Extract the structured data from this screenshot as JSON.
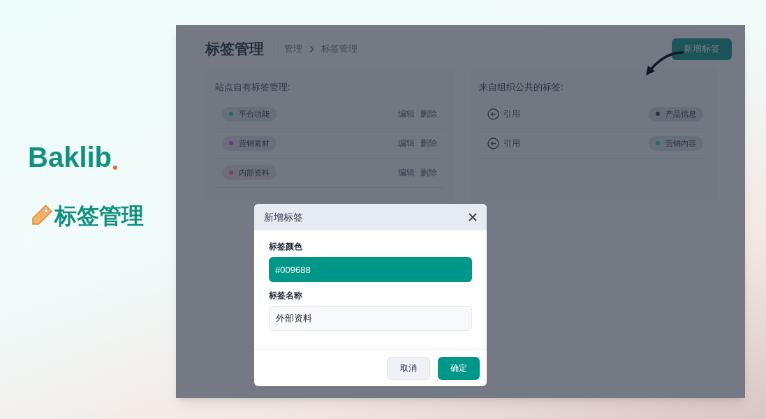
{
  "promo": {
    "brand": "Baklib",
    "headline": "标签管理"
  },
  "page": {
    "title": "标签管理",
    "breadcrumb": [
      "管理",
      "标签管理"
    ],
    "new_button": "新增标签",
    "own_tags": {
      "heading": "站点自有标签管理:",
      "items": [
        {
          "name": "平台功能",
          "color": "#1f6e68",
          "actions": [
            "编辑",
            "删除"
          ]
        },
        {
          "name": "营销素材",
          "color": "#6a3d78",
          "actions": [
            "编辑",
            "删除"
          ]
        },
        {
          "name": "内部资料",
          "color": "#8c3a5a",
          "actions": [
            "编辑",
            "删除"
          ]
        }
      ]
    },
    "org_tags": {
      "heading": "来自组织公共的标签:",
      "items": [
        {
          "action": "引用",
          "name": "产品信息",
          "color": "#2f3440"
        },
        {
          "action": "引用",
          "name": "营销内容",
          "color": "#1f6e68"
        }
      ]
    }
  },
  "dialog": {
    "title": "新增标签",
    "fields": [
      {
        "label": "标签颜色",
        "value": "#009688",
        "kind": "color"
      },
      {
        "label": "标签名称",
        "value": "外部资料",
        "kind": "text"
      }
    ],
    "buttons": [
      {
        "label": "取消",
        "kind": "secondary"
      },
      {
        "label": "确定",
        "kind": "primary"
      }
    ]
  }
}
